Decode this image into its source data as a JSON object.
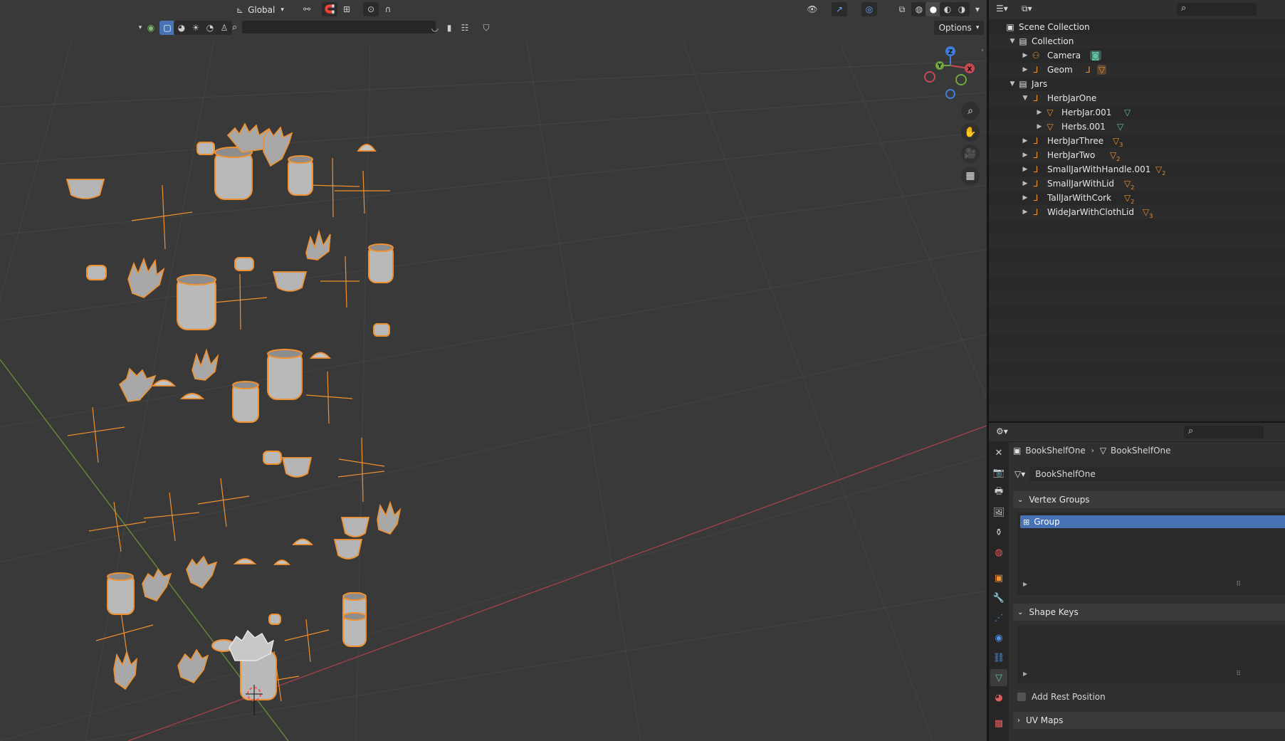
{
  "toolbar": {
    "transform_orientation": "Global",
    "options_label": "Options"
  },
  "gizmo": {
    "z": "Z",
    "y": "Y",
    "x": "X"
  },
  "outliner": {
    "rows": [
      {
        "label": "Scene Collection"
      },
      {
        "label": "Collection"
      },
      {
        "label": "Camera"
      },
      {
        "label": "Geom"
      },
      {
        "label": "Jars"
      },
      {
        "label": "HerbJarOne"
      },
      {
        "label": "HerbJar.001"
      },
      {
        "label": "Herbs.001"
      },
      {
        "label": "HerbJarThree",
        "count": "3"
      },
      {
        "label": "HerbJarTwo",
        "count": "2"
      },
      {
        "label": "SmallJarWithHandle.001",
        "count": "2"
      },
      {
        "label": "SmallJarWithLid",
        "count": "2"
      },
      {
        "label": "TallJarWithCork",
        "count": "2"
      },
      {
        "label": "WideJarWithClothLid",
        "count": "3"
      }
    ]
  },
  "properties": {
    "breadcrumb_object": "BookShelfOne",
    "breadcrumb_data": "BookShelfOne",
    "mesh_name": "BookShelfOne",
    "vertex_groups_title": "Vertex Groups",
    "vertex_groups": [
      "Group"
    ],
    "shape_keys_title": "Shape Keys",
    "add_rest_position_label": "Add Rest Position",
    "uv_maps_title": "UV Maps"
  },
  "colors": {
    "selection_orange": "#f0902e",
    "active_blue": "#4772b3",
    "x_axis": "#c74a54",
    "y_axis": "#6fa640",
    "z_axis": "#3d7fd6"
  }
}
